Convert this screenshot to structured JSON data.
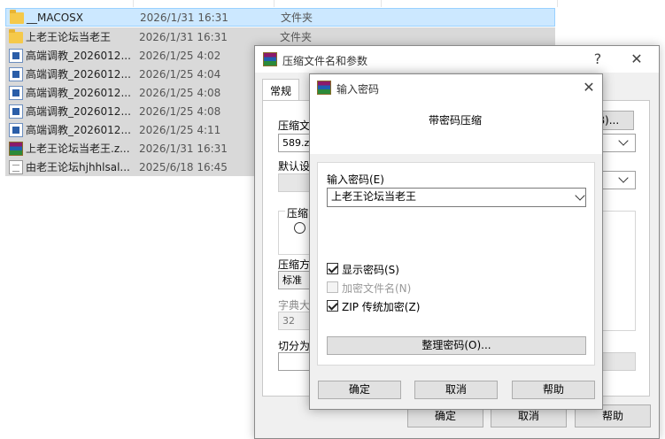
{
  "explorer": {
    "files": [
      {
        "name": "__MACOSX",
        "date": "2026/1/31 16:31",
        "type": "文件夹",
        "icon": "folder-icon"
      },
      {
        "name": "上老王论坛当老王",
        "date": "2026/1/31 16:31",
        "type": "文件夹",
        "icon": "folder-icon"
      },
      {
        "name": "高端调教_2026012...",
        "date": "2026/1/25 4:02",
        "type": "",
        "icon": "audio-file-icon"
      },
      {
        "name": "高端调教_2026012...",
        "date": "2026/1/25 4:04",
        "type": "",
        "icon": "audio-file-icon"
      },
      {
        "name": "高端调教_2026012...",
        "date": "2026/1/25 4:08",
        "type": "",
        "icon": "audio-file-icon"
      },
      {
        "name": "高端调教_2026012...",
        "date": "2026/1/25 4:08",
        "type": "",
        "icon": "audio-file-icon"
      },
      {
        "name": "高端调教_2026012...",
        "date": "2026/1/25 4:11",
        "type": "",
        "icon": "audio-file-icon"
      },
      {
        "name": "上老王论坛当老王.z...",
        "date": "2026/1/31 16:31",
        "type": "",
        "icon": "rar-archive-icon"
      },
      {
        "name": "由老王论坛hjhhlsal...",
        "date": "2025/6/18 16:45",
        "type": "",
        "icon": "text-file-icon"
      }
    ]
  },
  "archive_dialog": {
    "title": "压缩文件名和参数",
    "help_button": "?",
    "close_button": "✕",
    "tab_general": "常规",
    "archive_name_label": "压缩文",
    "archive_name_value": "589.zip",
    "browse_button": "B)...",
    "default_profile_label": "默认设",
    "format_group_label": "压缩",
    "method_label": "压缩方",
    "method_value": "标准",
    "dict_label": "字典大",
    "dict_value": "32",
    "split_label": "切分为",
    "ok_button": "确定",
    "cancel_button": "取消",
    "help_btn": "帮助"
  },
  "password_dialog": {
    "title": "输入密码",
    "close_button": "✕",
    "heading": "带密码压缩",
    "password_label": "输入密码(E)",
    "password_value": "上老王论坛当老王",
    "show_password_label": "显示密码(S)",
    "show_password_checked": true,
    "encrypt_names_label": "加密文件名(N)",
    "encrypt_names_checked": false,
    "zip_legacy_label": "ZIP 传统加密(Z)",
    "zip_legacy_checked": true,
    "organize_button": "整理密码(O)...",
    "ok_button": "确定",
    "cancel_button": "取消",
    "help_button": "帮助"
  },
  "colors": {
    "selection_blue": "#cce8ff",
    "selection_grey": "#d9d9d9",
    "dialog_bg": "#f0f0f0"
  }
}
